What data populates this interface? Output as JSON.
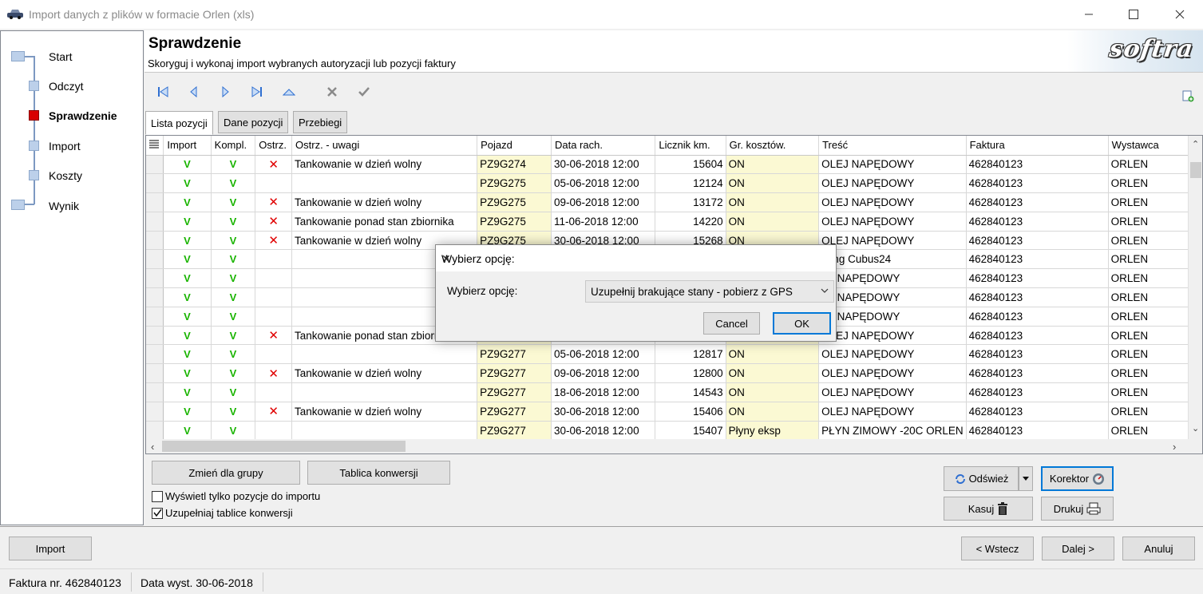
{
  "window": {
    "title": "Import danych z plików w formacie Orlen (xls)"
  },
  "wizard": {
    "steps": [
      "Start",
      "Odczyt",
      "Sprawdzenie",
      "Import",
      "Koszty",
      "Wynik"
    ],
    "active_step": "Sprawdzenie"
  },
  "header": {
    "title": "Sprawdzenie",
    "subtitle": "Skoryguj i wykonaj import wybranych autoryzacji lub pozycji faktury",
    "logo_text": "softra"
  },
  "tabs": [
    "Lista pozycji",
    "Dane pozycji",
    "Przebiegi"
  ],
  "grid": {
    "columns": [
      "Import",
      "Kompl.",
      "Ostrz.",
      "Ostrz. - uwagi",
      "Pojazd",
      "Data rach.",
      "Licznik km.",
      "Gr. kosztów.",
      "Treść",
      "Faktura",
      "Wystawca"
    ],
    "rows": [
      {
        "import": "V",
        "kompl": "V",
        "ostrz": "✕",
        "uwagi": "Tankowanie w dzień wolny",
        "pojazd": "PZ9G274",
        "data": "30-06-2018 12:00",
        "licznik": "15604",
        "gr": "ON",
        "tresc": "OLEJ NAPĘDOWY",
        "faktura": "462840123",
        "wystawca": "ORLEN"
      },
      {
        "import": "V",
        "kompl": "V",
        "ostrz": "",
        "uwagi": "",
        "pojazd": "PZ9G275",
        "data": "05-06-2018 12:00",
        "licznik": "12124",
        "gr": "ON",
        "tresc": "OLEJ NAPĘDOWY",
        "faktura": "462840123",
        "wystawca": "ORLEN"
      },
      {
        "import": "V",
        "kompl": "V",
        "ostrz": "✕",
        "uwagi": "Tankowanie w dzień wolny",
        "pojazd": "PZ9G275",
        "data": "09-06-2018 12:00",
        "licznik": "13172",
        "gr": "ON",
        "tresc": "OLEJ NAPĘDOWY",
        "faktura": "462840123",
        "wystawca": "ORLEN"
      },
      {
        "import": "V",
        "kompl": "V",
        "ostrz": "✕",
        "uwagi": "Tankowanie ponad stan zbiornika",
        "pojazd": "PZ9G275",
        "data": "11-06-2018 12:00",
        "licznik": "14220",
        "gr": "ON",
        "tresc": "OLEJ NAPĘDOWY",
        "faktura": "462840123",
        "wystawca": "ORLEN"
      },
      {
        "import": "V",
        "kompl": "V",
        "ostrz": "✕",
        "uwagi": "Tankowanie w dzień wolny",
        "pojazd": "PZ9G275",
        "data": "30-06-2018 12:00",
        "licznik": "15268",
        "gr": "ON",
        "tresc": "OLEJ NAPĘDOWY",
        "faktura": "462840123",
        "wystawca": "ORLEN"
      },
      {
        "import": "V",
        "kompl": "V",
        "ostrz": "",
        "uwagi": "",
        "pojazd": "",
        "data": "",
        "licznik": "",
        "gr": "",
        "tresc": "rking Cubus24",
        "faktura": "462840123",
        "wystawca": "ORLEN"
      },
      {
        "import": "V",
        "kompl": "V",
        "ostrz": "",
        "uwagi": "",
        "pojazd": "",
        "data": "",
        "licznik": "",
        "gr": "",
        "tresc": "EJ NAPĘDOWY",
        "faktura": "462840123",
        "wystawca": "ORLEN"
      },
      {
        "import": "V",
        "kompl": "V",
        "ostrz": "",
        "uwagi": "",
        "pojazd": "",
        "data": "",
        "licznik": "",
        "gr": "",
        "tresc": "EJ NAPĘDOWY",
        "faktura": "462840123",
        "wystawca": "ORLEN"
      },
      {
        "import": "V",
        "kompl": "V",
        "ostrz": "",
        "uwagi": "",
        "pojazd": "",
        "data": "",
        "licznik": "",
        "gr": "",
        "tresc": "EJ NAPĘDOWY",
        "faktura": "462840123",
        "wystawca": "ORLEN"
      },
      {
        "import": "V",
        "kompl": "V",
        "ostrz": "✕",
        "uwagi": "Tankowanie ponad stan zbiornika",
        "pojazd": "",
        "data": "",
        "licznik": "",
        "gr": "ON",
        "tresc": "OLEJ NAPĘDOWY",
        "faktura": "462840123",
        "wystawca": "ORLEN"
      },
      {
        "import": "V",
        "kompl": "V",
        "ostrz": "",
        "uwagi": "",
        "pojazd": "PZ9G277",
        "data": "05-06-2018 12:00",
        "licznik": "12817",
        "gr": "ON",
        "tresc": "OLEJ NAPĘDOWY",
        "faktura": "462840123",
        "wystawca": "ORLEN"
      },
      {
        "import": "V",
        "kompl": "V",
        "ostrz": "✕",
        "uwagi": "Tankowanie w dzień wolny",
        "pojazd": "PZ9G277",
        "data": "09-06-2018 12:00",
        "licznik": "12800",
        "gr": "ON",
        "tresc": "OLEJ NAPĘDOWY",
        "faktura": "462840123",
        "wystawca": "ORLEN"
      },
      {
        "import": "V",
        "kompl": "V",
        "ostrz": "",
        "uwagi": "",
        "pojazd": "PZ9G277",
        "data": "18-06-2018 12:00",
        "licznik": "14543",
        "gr": "ON",
        "tresc": "OLEJ NAPĘDOWY",
        "faktura": "462840123",
        "wystawca": "ORLEN"
      },
      {
        "import": "V",
        "kompl": "V",
        "ostrz": "✕",
        "uwagi": "Tankowanie w dzień wolny",
        "pojazd": "PZ9G277",
        "data": "30-06-2018 12:00",
        "licznik": "15406",
        "gr": "ON",
        "tresc": "OLEJ NAPĘDOWY",
        "faktura": "462840123",
        "wystawca": "ORLEN"
      },
      {
        "import": "V",
        "kompl": "V",
        "ostrz": "",
        "uwagi": "",
        "pojazd": "PZ9G277",
        "data": "30-06-2018 12:00",
        "licznik": "15407",
        "gr": "Płyny eksp",
        "tresc": "PŁYN ZIMOWY -20C ORLEN",
        "faktura": "462840123",
        "wystawca": "ORLEN"
      }
    ]
  },
  "panel": {
    "change_group": "Zmień dla grupy",
    "conversion_table": "Tablica konwersji",
    "only_import_label": "Wyświetl tylko pozycje do importu",
    "only_import_checked": false,
    "fill_conversion_label": "Uzupełniaj tablice konwersji",
    "fill_conversion_checked": true,
    "refresh": "Odśwież",
    "corrector": "Korektor",
    "delete": "Kasuj",
    "print": "Drukuj"
  },
  "footer": {
    "import": "Import",
    "back": "< Wstecz",
    "next": "Dalej >",
    "cancel": "Anuluj"
  },
  "status": {
    "invoice": "Faktura nr. 462840123",
    "issue_date": "Data wyst. 30-06-2018"
  },
  "dialog": {
    "title": "Wybierz opcję:",
    "label": "Wybierz opcję:",
    "selected": "Uzupełnij brakujące stany - pobierz z GPS",
    "cancel": "Cancel",
    "ok": "OK"
  }
}
